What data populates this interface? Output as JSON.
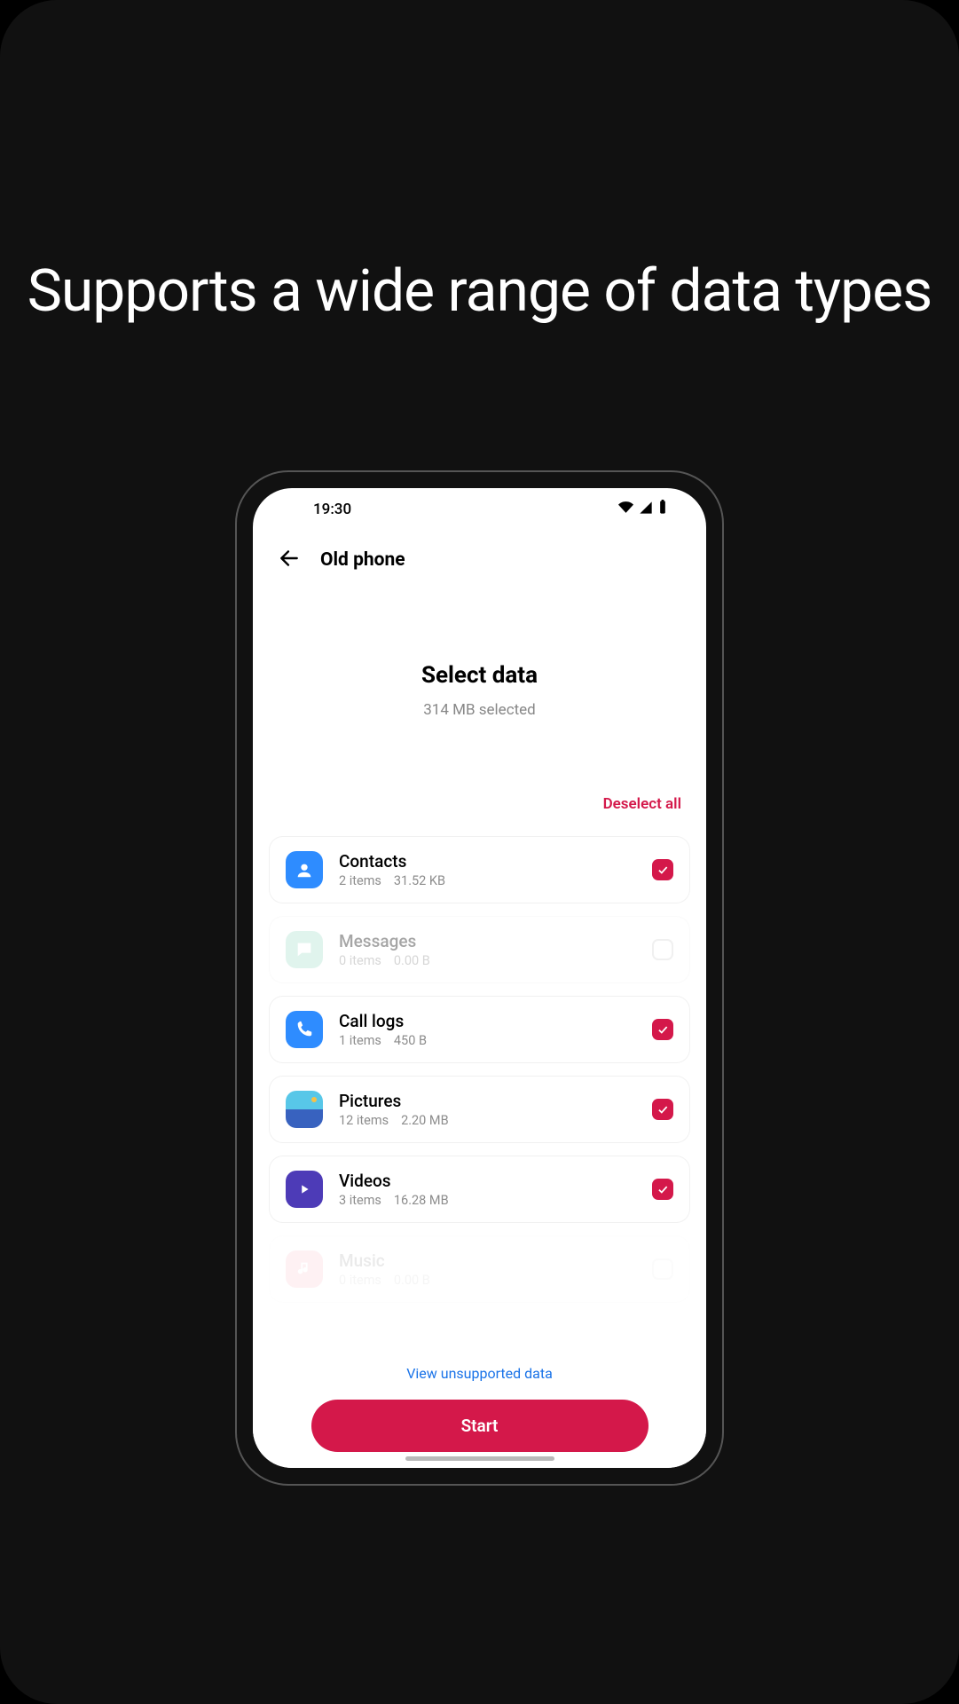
{
  "headline": "Supports a wide range of data types",
  "status": {
    "time": "19:30"
  },
  "nav": {
    "title": "Old phone"
  },
  "select": {
    "title": "Select data",
    "subtitle": "314 MB selected"
  },
  "deselect_label": "Deselect all",
  "items": {
    "contacts": {
      "title": "Contacts",
      "count": "2 items",
      "size": "31.52 KB"
    },
    "messages": {
      "title": "Messages",
      "count": "0 items",
      "size": "0.00 B"
    },
    "calllogs": {
      "title": "Call logs",
      "count": "1 items",
      "size": "450 B"
    },
    "pictures": {
      "title": "Pictures",
      "count": "12 items",
      "size": "2.20 MB"
    },
    "videos": {
      "title": "Videos",
      "count": "3 items",
      "size": "16.28 MB"
    },
    "music": {
      "title": "Music",
      "count": "0 items",
      "size": "0.00 B"
    }
  },
  "footer": {
    "unsupported": "View unsupported data",
    "start": "Start"
  },
  "colors": {
    "accent": "#d4184a",
    "link": "#1a73e8"
  }
}
